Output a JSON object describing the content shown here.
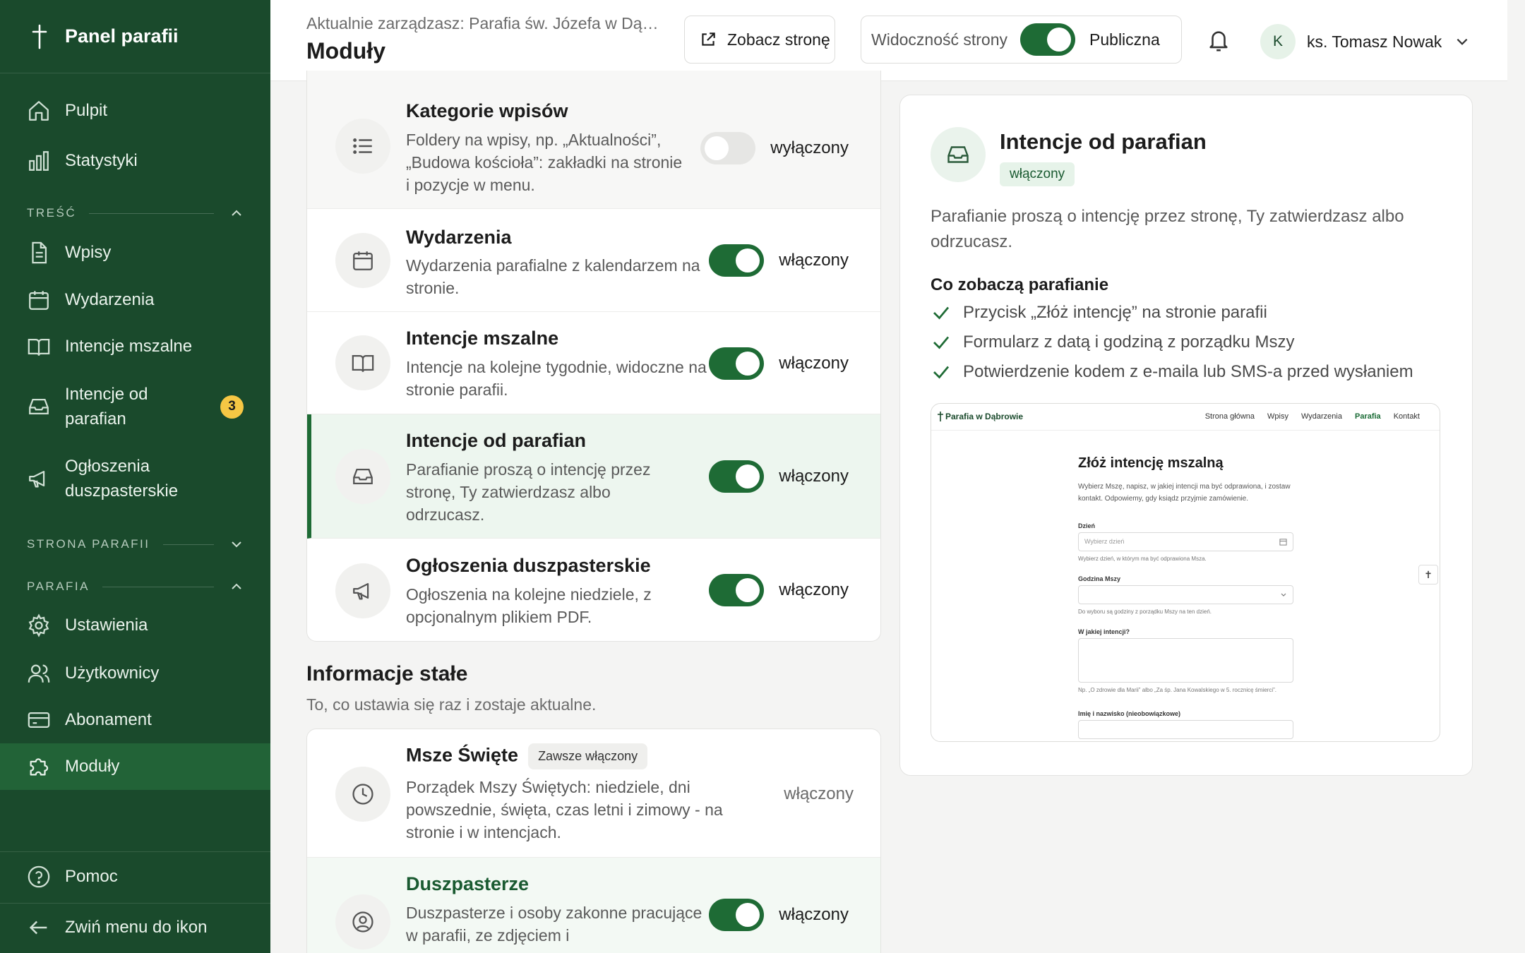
{
  "sidebar": {
    "brand": "Panel parafii",
    "top_items": [
      {
        "label": "Pulpit"
      },
      {
        "label": "Statystyki"
      }
    ],
    "sections": [
      {
        "title": "TREŚĆ"
      },
      {
        "title": "STRONA PARAFII"
      },
      {
        "title": "PARAFIA"
      }
    ],
    "content_items": [
      {
        "label": "Wpisy"
      },
      {
        "label": "Wydarzenia"
      },
      {
        "label": "Intencje mszalne"
      },
      {
        "label": "Intencje od parafian",
        "badge": "3"
      },
      {
        "label": "Ogłoszenia duszpasterskie"
      }
    ],
    "parish_items": [
      {
        "label": "Ustawienia"
      },
      {
        "label": "Użytkownicy"
      },
      {
        "label": "Abonament"
      },
      {
        "label": "Moduły"
      }
    ],
    "bottom_items": [
      {
        "label": "Pomoc"
      },
      {
        "label": "Zwiń menu do ikon"
      }
    ]
  },
  "header": {
    "subtitle": "Aktualnie zarządzasz: Parafia św. Józefa w Dąbrowie",
    "title": "Moduły",
    "view_button": "Zobacz stronę",
    "visibility_label": "Widoczność strony",
    "visibility_state": "Publiczna",
    "user_initial": "K",
    "user_name": "ks. Tomasz Nowak"
  },
  "modules": [
    {
      "title": "Kategorie wpisów",
      "desc": "Foldery na wpisy, np. „Aktualności”, „Budowa kościoła”: zakładki na stronie i pozycje w menu.",
      "state": "wyłączony",
      "enabled": false
    },
    {
      "title": "Wydarzenia",
      "desc": "Wydarzenia parafialne z kalendarzem na stronie.",
      "state": "włączony",
      "enabled": true
    },
    {
      "title": "Intencje mszalne",
      "desc": "Intencje na kolejne tygodnie, widoczne na stronie parafii.",
      "state": "włączony",
      "enabled": true
    },
    {
      "title": "Intencje od parafian",
      "desc": "Parafianie proszą o intencję przez stronę, Ty zatwierdzasz albo odrzucasz.",
      "state": "włączony",
      "enabled": true
    },
    {
      "title": "Ogłoszenia duszpasterskie",
      "desc": "Ogłoszenia na kolejne niedziele, z opcjonalnym plikiem PDF.",
      "state": "włączony",
      "enabled": true
    }
  ],
  "fixed_section": {
    "title": "Informacje stałe",
    "subtitle": "To, co ustawia się raz i zostaje aktualne.",
    "modules": [
      {
        "title": "Msze Święte",
        "pill": "Zawsze włączony",
        "desc": "Porządek Mszy Świętych: niedziele, dni powszednie, święta, czas letni i zimowy - na stronie i w intencjach.",
        "state": "włączony"
      },
      {
        "title": "Duszpasterze",
        "desc": "Duszpasterze i osoby zakonne pracujące w parafii, ze zdjęciem i",
        "state": "włączony",
        "enabled": true
      }
    ]
  },
  "detail": {
    "title": "Intencje od parafian",
    "badge": "włączony",
    "desc": "Parafianie proszą o intencję przez stronę, Ty zatwierdzasz albo odrzucasz.",
    "features_title": "Co zobaczą parafianie",
    "features": [
      "Przycisk „Złóż intencję” na stronie parafii",
      "Formularz z datą i godziną z porządku Mszy",
      "Potwierdzenie kodem z e-maila lub SMS-a przed wysłaniem"
    ],
    "preview": {
      "brand": "Parafia w Dąbrowie",
      "nav": [
        "Strona główna",
        "Wpisy",
        "Wydarzenia",
        "Parafia",
        "Kontakt"
      ],
      "heading": "Złóż intencję mszalną",
      "intro": "Wybierz Mszę, napisz, w jakiej intencji ma być odprawiona, i zostaw kontakt. Odpowiemy, gdy ksiądz przyjmie zamówienie.",
      "day_label": "Dzień",
      "day_placeholder": "Wybierz dzień",
      "day_help": "Wybierz dzień, w którym ma być odprawiona Msza.",
      "hour_label": "Godzina Mszy",
      "hour_help": "Do wyboru są godziny z porządku Mszy na ten dzień.",
      "intent_label": "W jakiej intencji?",
      "intent_help": "Np. „O zdrowie dla Marii” albo „Za śp. Jana Kowalskiego w 5. rocznicę śmierci”.",
      "name_label": "Imię i nazwisko (nieobowiązkowe)"
    }
  }
}
